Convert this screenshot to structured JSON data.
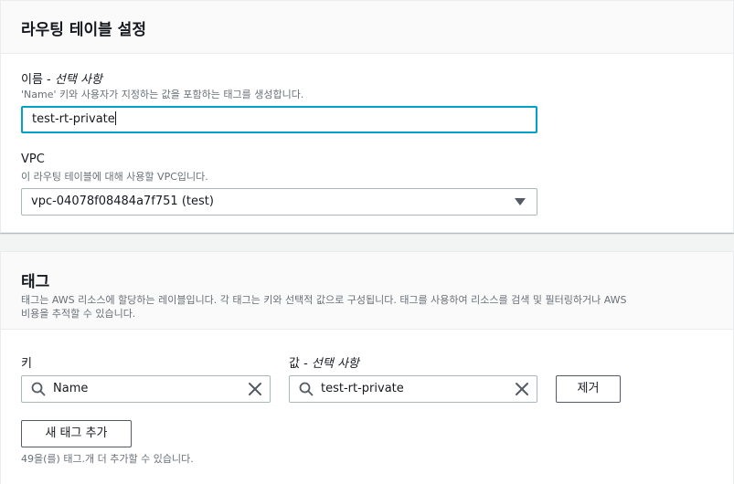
{
  "route_table": {
    "title": "라우팅 테이블 설정",
    "name_label": "이름 - ",
    "name_optional": "선택 사항",
    "name_desc": "'Name' 키와 사용자가 지정하는 값을 포함하는 태그를 생성합니다.",
    "name_value": "test-rt-private",
    "vpc_label": "VPC",
    "vpc_desc": "이 라우팅 테이블에 대해 사용할 VPC입니다.",
    "vpc_value": "vpc-04078f08484a7f751 (test)"
  },
  "tags": {
    "title": "태그",
    "desc_line1": "태그는 AWS 리소스에 할당하는 레이블입니다. 각 태그는 키와 선택적 값으로 구성됩니다. 태그를 사용하여 리소스를 검색 및 필터링하거나 AWS",
    "desc_line2": "비용을 추적할 수 있습니다.",
    "key_label": "키",
    "value_label": "값 - ",
    "value_optional": "선택 사항",
    "key_value": "Name",
    "value_value": "test-rt-private",
    "remove_button": "제거",
    "add_button": "새 태그 추가",
    "remaining_text": "49을(를) 태그.개 더 추가할 수 있습니다."
  },
  "colors": {
    "focus": "#00a1c9",
    "border": "#aab7b8",
    "muted": "#687078"
  },
  "icons": [
    "search-icon",
    "clear-icon",
    "dropdown-caret-icon"
  ]
}
